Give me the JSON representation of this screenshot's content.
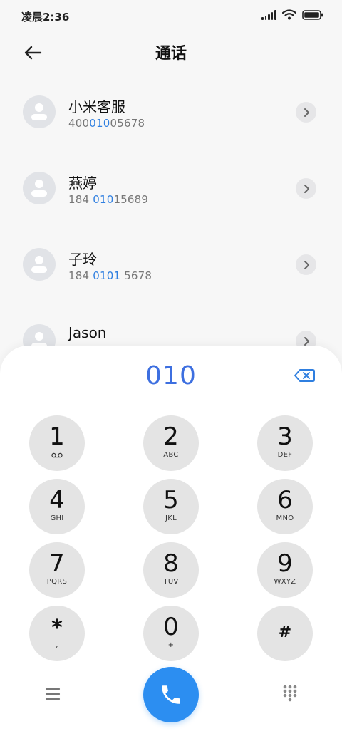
{
  "status_bar": {
    "time": "凌晨2:36",
    "signal_icon": "signal-icon",
    "wifi_icon": "wifi-icon",
    "battery_icon": "battery-icon"
  },
  "header": {
    "back_icon": "arrow-left-icon",
    "title": "通话"
  },
  "contacts": [
    {
      "name": "小米客服",
      "number_parts": [
        "400",
        "010",
        "05678"
      ]
    },
    {
      "name": "燕婷",
      "number_parts": [
        "184 ",
        "010",
        "15689"
      ]
    },
    {
      "name": "子玲",
      "number_parts": [
        "184 ",
        "0101",
        " 5678"
      ]
    },
    {
      "name": "Jason",
      "number_parts": [
        "",
        "",
        ""
      ]
    }
  ],
  "dialer": {
    "input": "010",
    "backspace_icon": "backspace-icon",
    "keys": [
      {
        "digit": "1",
        "letters": "",
        "icon": "voicemail-icon"
      },
      {
        "digit": "2",
        "letters": "ABC"
      },
      {
        "digit": "3",
        "letters": "DEF"
      },
      {
        "digit": "4",
        "letters": "GHI"
      },
      {
        "digit": "5",
        "letters": "JKL"
      },
      {
        "digit": "6",
        "letters": "MNO"
      },
      {
        "digit": "7",
        "letters": "PQRS"
      },
      {
        "digit": "8",
        "letters": "TUV"
      },
      {
        "digit": "9",
        "letters": "WXYZ"
      },
      {
        "digit": "*",
        "letters": ","
      },
      {
        "digit": "0",
        "letters": "+"
      },
      {
        "digit": "#",
        "letters": ""
      }
    ],
    "menu_icon": "menu-icon",
    "call_icon": "phone-icon",
    "dialpad_icon": "dialpad-icon"
  },
  "colors": {
    "accent": "#3d6fe0",
    "highlight": "#2f7fe0",
    "call_button": "#2c8ef1"
  }
}
